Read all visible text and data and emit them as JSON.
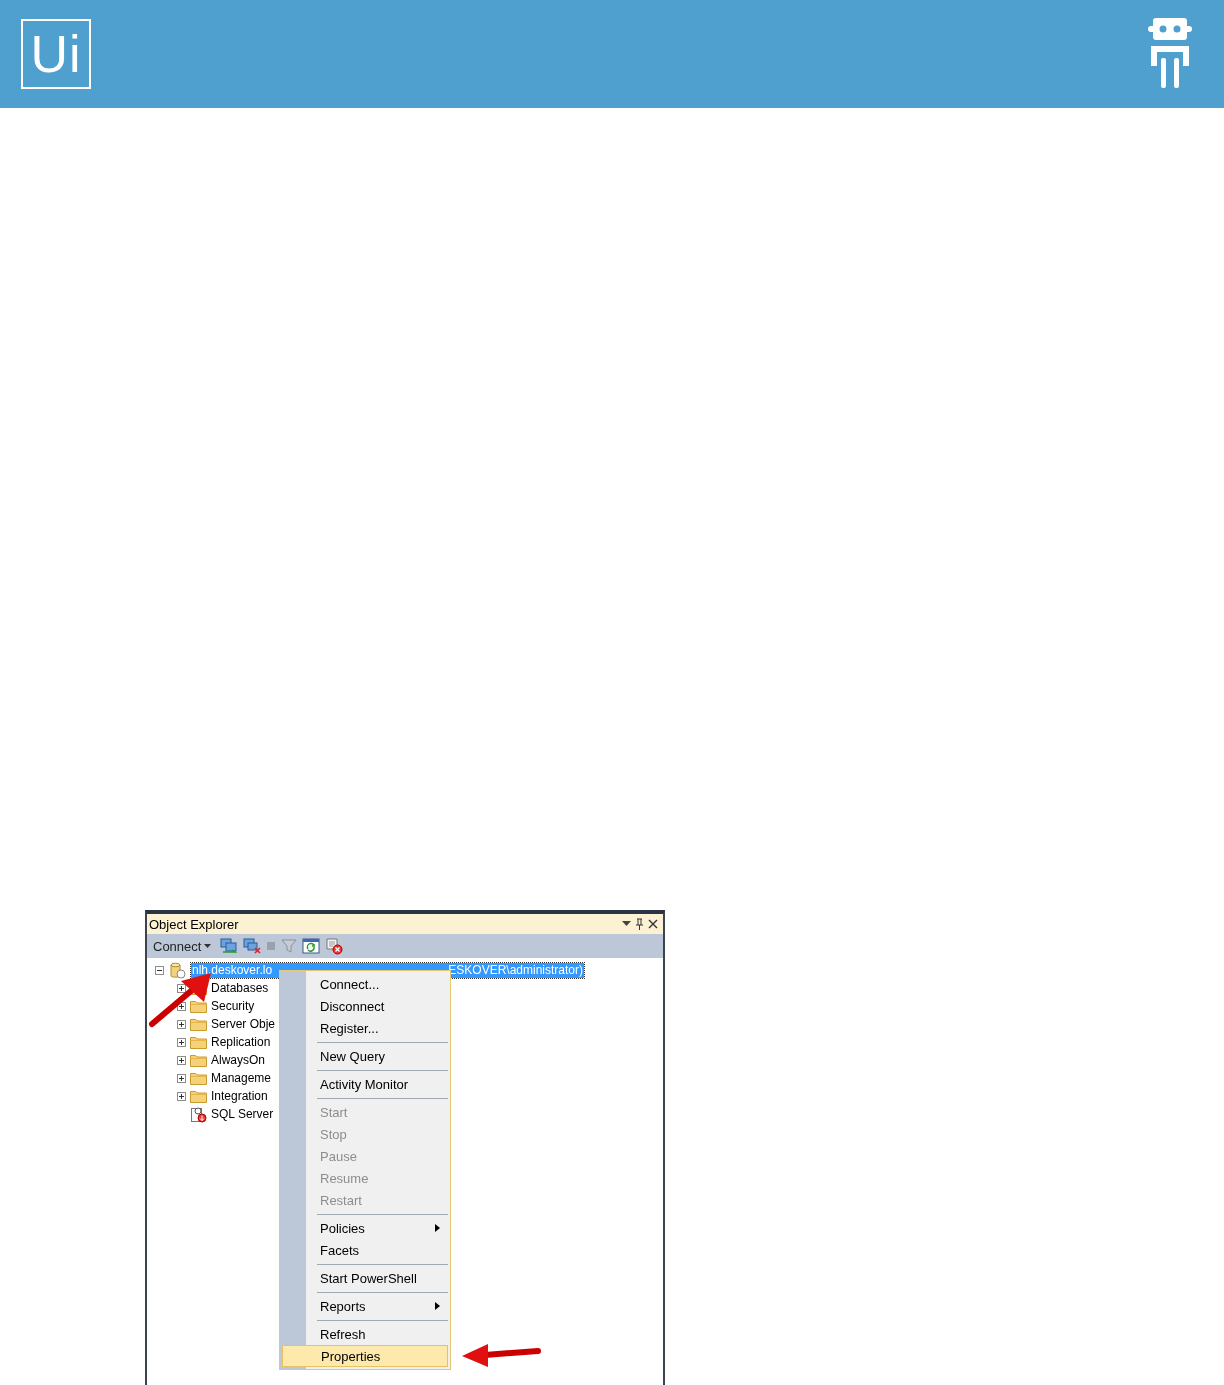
{
  "header": {
    "logo": "Ui"
  },
  "object_explorer": {
    "title": "Object Explorer",
    "toolbar": {
      "connect": "Connect"
    },
    "tree": [
      {
        "kind": "server",
        "label_start": "nlh.deskover.lo",
        "label_end": "ESKOVER\\administrator)",
        "expanded": true,
        "selected": true,
        "children": [
          {
            "kind": "folder",
            "label": "Databases",
            "expanded": false
          },
          {
            "kind": "folder",
            "label": "Security",
            "expanded": false
          },
          {
            "kind": "folder",
            "label": "Server Obje",
            "expanded": false
          },
          {
            "kind": "folder",
            "label": "Replication",
            "expanded": false
          },
          {
            "kind": "folder",
            "label": "AlwaysOn",
            "expanded": false
          },
          {
            "kind": "folder",
            "label": "Manageme",
            "expanded": false
          },
          {
            "kind": "folder",
            "label": "Integration",
            "expanded": false
          },
          {
            "kind": "agent",
            "label": "SQL Server"
          }
        ]
      }
    ],
    "context_menu": [
      {
        "kind": "item",
        "label": "Connect...",
        "disabled": false,
        "selected": false,
        "submenu": false
      },
      {
        "kind": "item",
        "label": "Disconnect",
        "disabled": false,
        "selected": false,
        "submenu": false
      },
      {
        "kind": "item",
        "label": "Register...",
        "disabled": false,
        "selected": false,
        "submenu": false
      },
      {
        "kind": "separator"
      },
      {
        "kind": "item",
        "label": "New Query",
        "disabled": false,
        "selected": false,
        "submenu": false
      },
      {
        "kind": "separator"
      },
      {
        "kind": "item",
        "label": "Activity Monitor",
        "disabled": false,
        "selected": false,
        "submenu": false
      },
      {
        "kind": "separator"
      },
      {
        "kind": "item",
        "label": "Start",
        "disabled": true,
        "selected": false,
        "submenu": false
      },
      {
        "kind": "item",
        "label": "Stop",
        "disabled": true,
        "selected": false,
        "submenu": false
      },
      {
        "kind": "item",
        "label": "Pause",
        "disabled": true,
        "selected": false,
        "submenu": false
      },
      {
        "kind": "item",
        "label": "Resume",
        "disabled": true,
        "selected": false,
        "submenu": false
      },
      {
        "kind": "item",
        "label": "Restart",
        "disabled": true,
        "selected": false,
        "submenu": false
      },
      {
        "kind": "separator"
      },
      {
        "kind": "item",
        "label": "Policies",
        "disabled": false,
        "selected": false,
        "submenu": true
      },
      {
        "kind": "item",
        "label": "Facets",
        "disabled": false,
        "selected": false,
        "submenu": false
      },
      {
        "kind": "separator"
      },
      {
        "kind": "item",
        "label": "Start PowerShell",
        "disabled": false,
        "selected": false,
        "submenu": false
      },
      {
        "kind": "separator"
      },
      {
        "kind": "item",
        "label": "Reports",
        "disabled": false,
        "selected": false,
        "submenu": true
      },
      {
        "kind": "separator"
      },
      {
        "kind": "item",
        "label": "Refresh",
        "disabled": false,
        "selected": false,
        "submenu": false
      },
      {
        "kind": "item",
        "label": "Properties",
        "disabled": false,
        "selected": true,
        "submenu": false
      }
    ]
  }
}
